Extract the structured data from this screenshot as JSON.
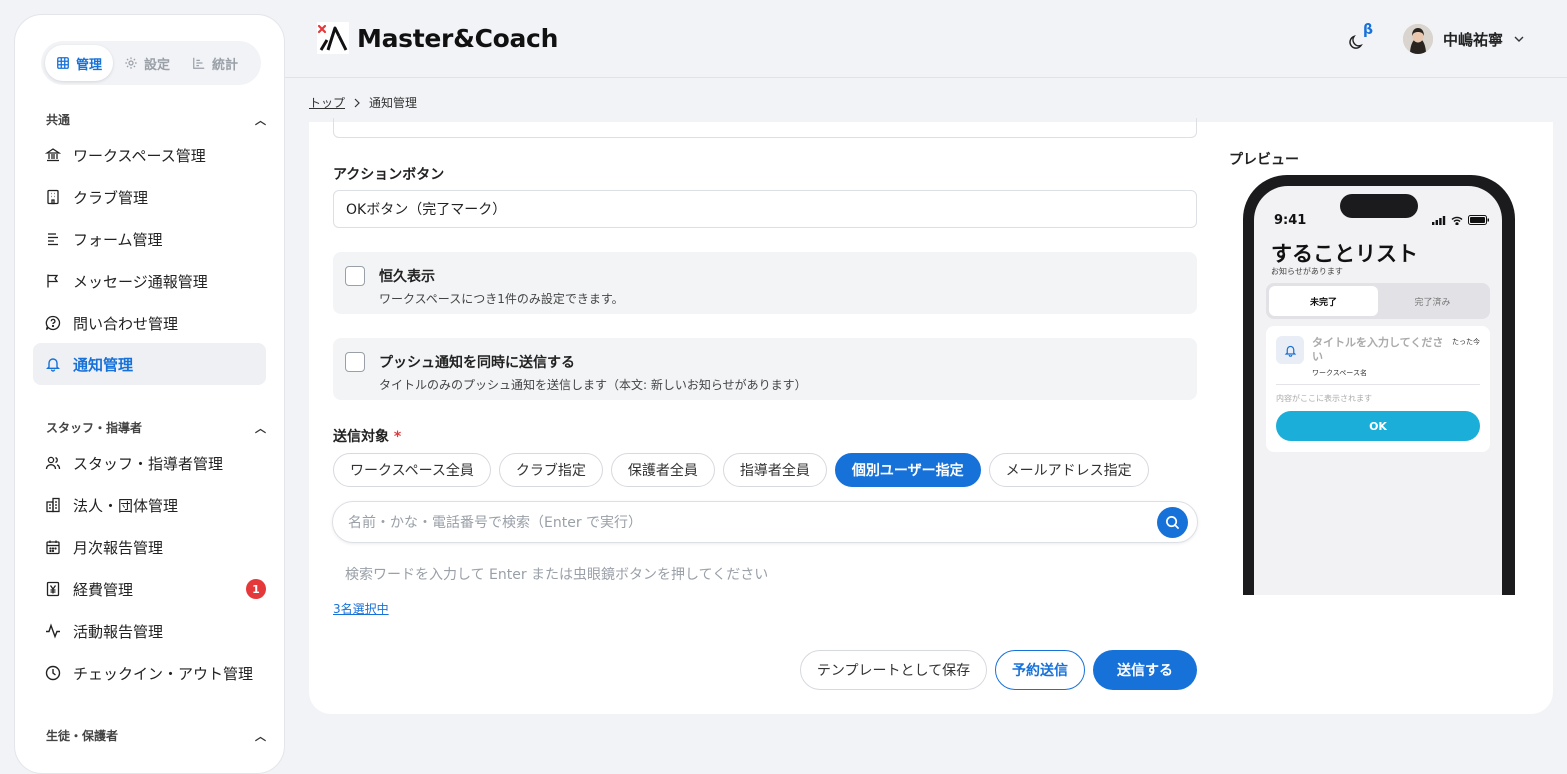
{
  "sidebar": {
    "tabs": [
      {
        "label": "管理",
        "icon": "grid-icon"
      },
      {
        "label": "設定",
        "icon": "gear-icon"
      },
      {
        "label": "統計",
        "icon": "chart-icon"
      }
    ],
    "sections": [
      {
        "title": "共通"
      },
      {
        "title": "スタッフ・指導者"
      },
      {
        "title": "生徒・保護者"
      }
    ],
    "items": [
      {
        "label": "ワークスペース管理",
        "icon": "bank-icon"
      },
      {
        "label": "クラブ管理",
        "icon": "building-icon"
      },
      {
        "label": "フォーム管理",
        "icon": "form-icon"
      },
      {
        "label": "メッセージ通報管理",
        "icon": "flag-icon"
      },
      {
        "label": "問い合わせ管理",
        "icon": "question-icon"
      },
      {
        "label": "通知管理",
        "icon": "bell-icon"
      },
      {
        "label": "スタッフ・指導者管理",
        "icon": "users-icon"
      },
      {
        "label": "法人・団体管理",
        "icon": "office-icon"
      },
      {
        "label": "月次報告管理",
        "icon": "calendar-icon"
      },
      {
        "label": "経費管理",
        "icon": "yen-icon",
        "badge": "1"
      },
      {
        "label": "活動報告管理",
        "icon": "activity-icon"
      },
      {
        "label": "チェックイン・アウト管理",
        "icon": "clock-icon"
      }
    ],
    "active_item": "通知管理"
  },
  "header": {
    "brand": "Master&Coach",
    "beta": "β",
    "user_name": "中嶋祐寧"
  },
  "breadcrumb": {
    "home": "トップ",
    "current": "通知管理"
  },
  "form": {
    "action_label": "アクションボタン",
    "action_value": "OKボタン（完了マーク）",
    "permanent_title": "恒久表示",
    "permanent_desc": "ワークスペースにつき1件のみ設定できます。",
    "push_title": "プッシュ通知を同時に送信する",
    "push_desc": "タイトルのみのプッシュ通知を送信します（本文: 新しいお知らせがあります）",
    "target_label": "送信対象",
    "required_mark": "*",
    "targets": [
      "ワークスペース全員",
      "クラブ指定",
      "保護者全員",
      "指導者全員",
      "個別ユーザー指定",
      "メールアドレス指定"
    ],
    "active_target": "個別ユーザー指定",
    "search_placeholder": "名前・かな・電話番号で検索（Enter で実行）",
    "search_hint": "検索ワードを入力して Enter または虫眼鏡ボタンを押してください",
    "selected_count": "3名選択中",
    "save_template": "テンプレートとして保存",
    "schedule": "予約送信",
    "send": "送信する"
  },
  "preview": {
    "label": "プレビュー",
    "time": "9:41",
    "title": "することリスト",
    "subtitle": "お知らせがあります",
    "tab_incomplete": "未完了",
    "tab_done": "完了済み",
    "card_title": "タイトルを入力してください",
    "card_time": "たった今",
    "workspace": "ワークスペース名",
    "body": "内容がここに表示されます",
    "ok": "OK"
  },
  "colors": {
    "accent": "#1671d9",
    "badge": "#e5383b",
    "ok_button": "#1aaed8"
  }
}
